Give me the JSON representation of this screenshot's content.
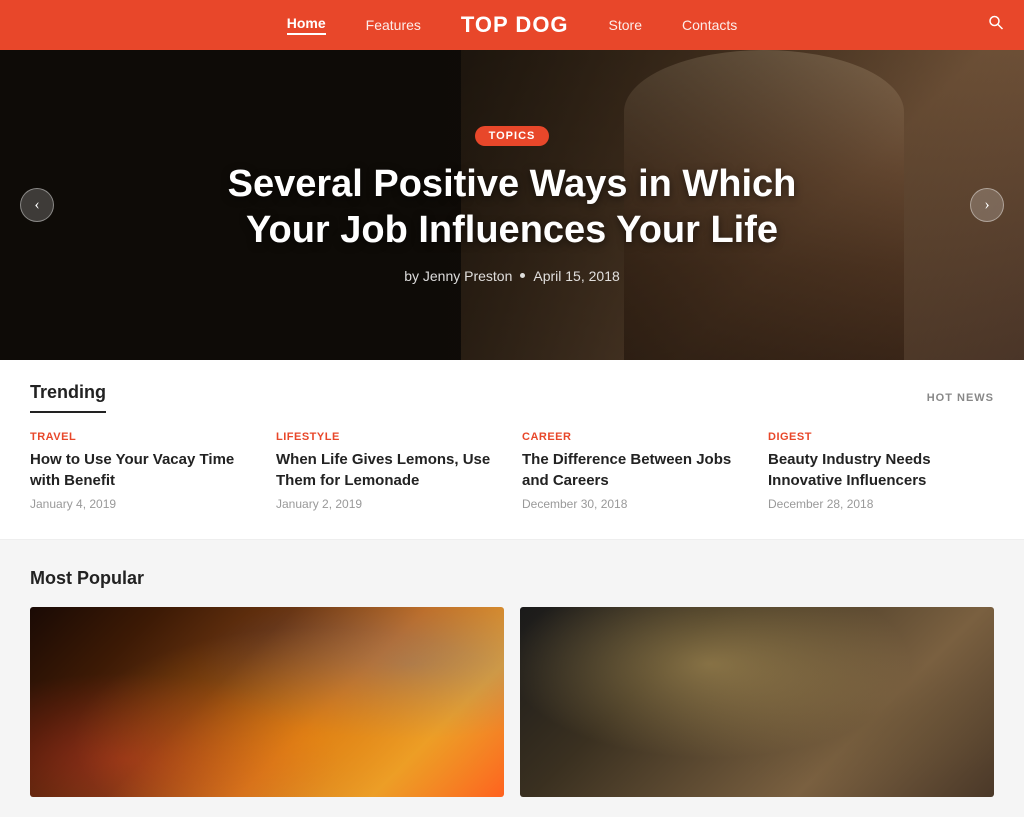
{
  "header": {
    "logo": "TOP DOG",
    "nav": [
      {
        "label": "Home",
        "active": true
      },
      {
        "label": "Features",
        "active": false
      },
      {
        "label": "Store",
        "active": false
      },
      {
        "label": "Contacts",
        "active": false
      }
    ],
    "search_icon": "🔍"
  },
  "hero": {
    "badge": "TOPICS",
    "title": "Several Positive Ways in Which Your Job Influences Your Life",
    "author": "by Jenny Preston",
    "date": "April 15, 2018",
    "arrow_left": "‹",
    "arrow_right": "›"
  },
  "trending": {
    "title": "Trending",
    "hot_news_label": "HOT NEWS",
    "items": [
      {
        "category": "TRAVEL",
        "category_class": "cat-travel",
        "title": "How to Use Your Vacay Time with Benefit",
        "date": "January 4, 2019"
      },
      {
        "category": "LIFESTYLE",
        "category_class": "cat-lifestyle",
        "title": "When Life Gives Lemons, Use Them for Lemonade",
        "date": "January 2, 2019"
      },
      {
        "category": "CAREER",
        "category_class": "cat-career",
        "title": "The Difference Between Jobs and Careers",
        "date": "December 30, 2018"
      },
      {
        "category": "DIGEST",
        "category_class": "cat-digest",
        "title": "Beauty Industry Needs Innovative Influencers",
        "date": "December 28, 2018"
      }
    ]
  },
  "most_popular": {
    "title": "Most Popular",
    "cards": [
      {
        "id": "city-night",
        "style": "left"
      },
      {
        "id": "office-meeting",
        "style": "right"
      }
    ]
  }
}
